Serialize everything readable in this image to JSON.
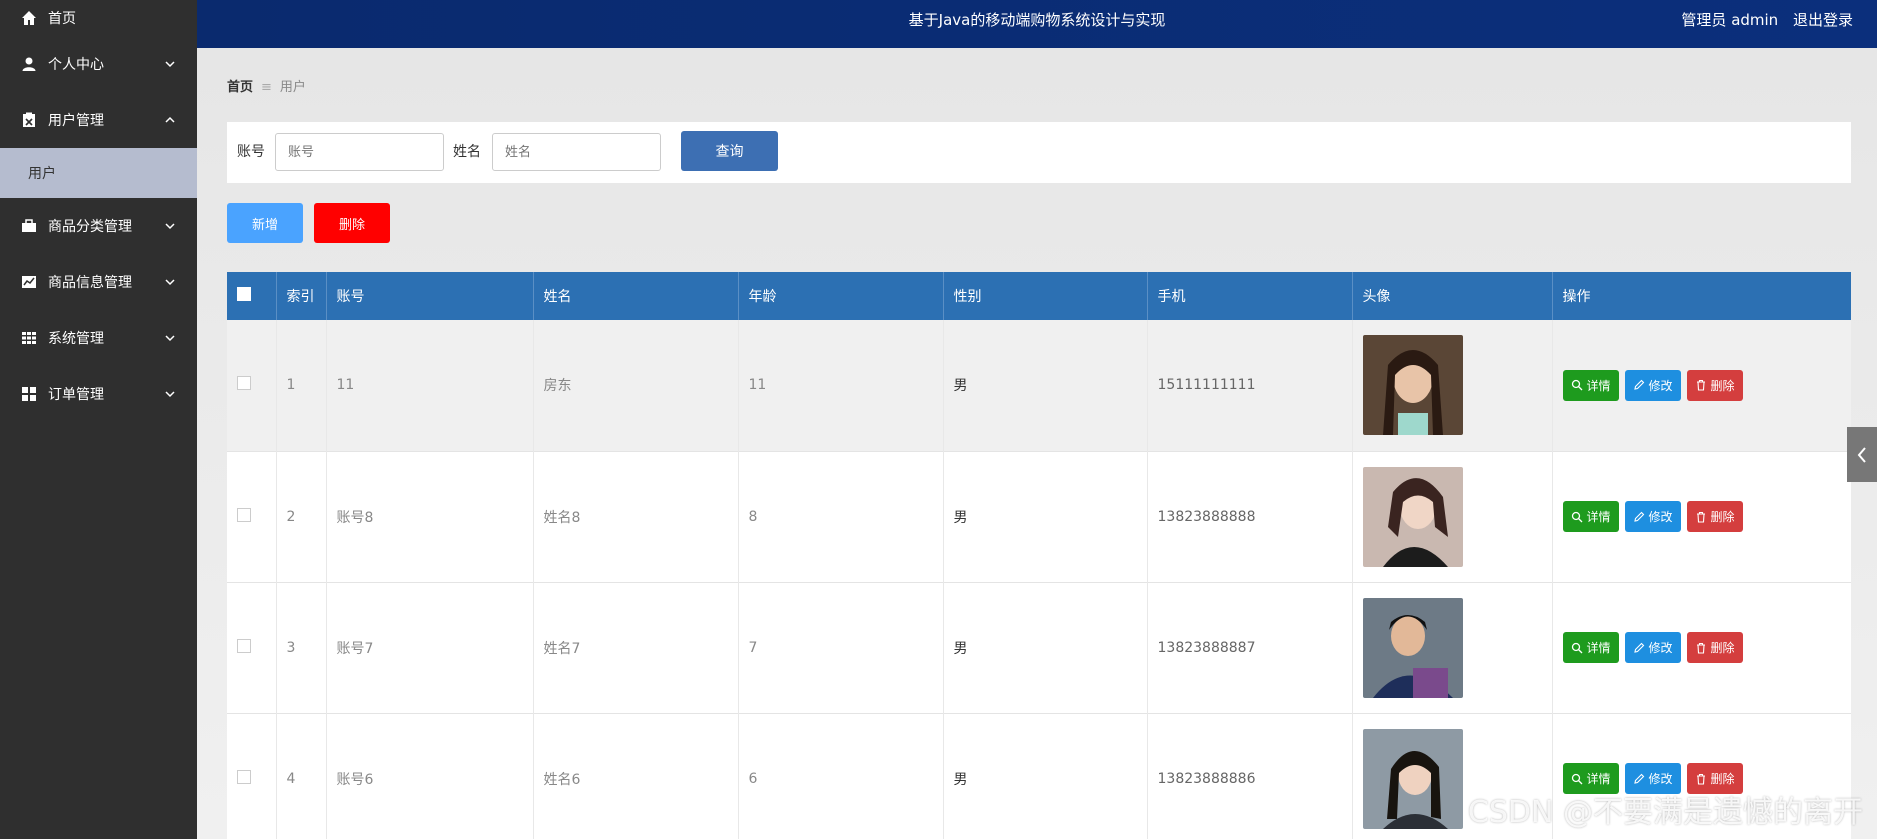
{
  "header": {
    "title": "基于Java的移动端购物系统设计与实现",
    "role": "管理员 admin",
    "logout": "退出登录"
  },
  "sidebar": {
    "items": [
      {
        "label": "首页",
        "icon": "home-icon"
      },
      {
        "label": "个人中心",
        "icon": "user-icon"
      },
      {
        "label": "用户管理",
        "icon": "clipboard-icon"
      },
      {
        "label": "商品分类管理",
        "icon": "briefcase-icon"
      },
      {
        "label": "商品信息管理",
        "icon": "chart-icon"
      },
      {
        "label": "系统管理",
        "icon": "grid-icon"
      },
      {
        "label": "订单管理",
        "icon": "tiles-icon"
      }
    ],
    "sub_item": "用户"
  },
  "breadcrumb": {
    "home": "首页",
    "current": "用户"
  },
  "search": {
    "account_label": "账号",
    "account_placeholder": "账号",
    "name_label": "姓名",
    "name_placeholder": "姓名",
    "query_button": "查询"
  },
  "actions": {
    "add": "新增",
    "delete": "删除"
  },
  "table": {
    "columns": [
      "索引",
      "账号",
      "姓名",
      "年龄",
      "性别",
      "手机",
      "头像",
      "操作"
    ],
    "rows": [
      {
        "index": "1",
        "account": "11",
        "name": "房东",
        "age": "11",
        "gender": "男",
        "phone": "15111111111"
      },
      {
        "index": "2",
        "account": "账号8",
        "name": "姓名8",
        "age": "8",
        "gender": "男",
        "phone": "13823888888"
      },
      {
        "index": "3",
        "account": "账号7",
        "name": "姓名7",
        "age": "7",
        "gender": "男",
        "phone": "13823888887"
      },
      {
        "index": "4",
        "account": "账号6",
        "name": "姓名6",
        "age": "6",
        "gender": "男",
        "phone": "13823888886"
      }
    ],
    "op_labels": {
      "detail": "详情",
      "edit": "修改",
      "remove": "删除"
    }
  },
  "watermark": "CSDN @不要满是遗憾的离开",
  "colors": {
    "header": "#0b2f7c",
    "sidebar": "#2f2f2f",
    "table_header": "#2c70b3",
    "detail": "#1e9b1e",
    "edit": "#1e8fe0",
    "remove": "#d43e3e",
    "add": "#4aa3ff",
    "delete": "#ff0000"
  }
}
